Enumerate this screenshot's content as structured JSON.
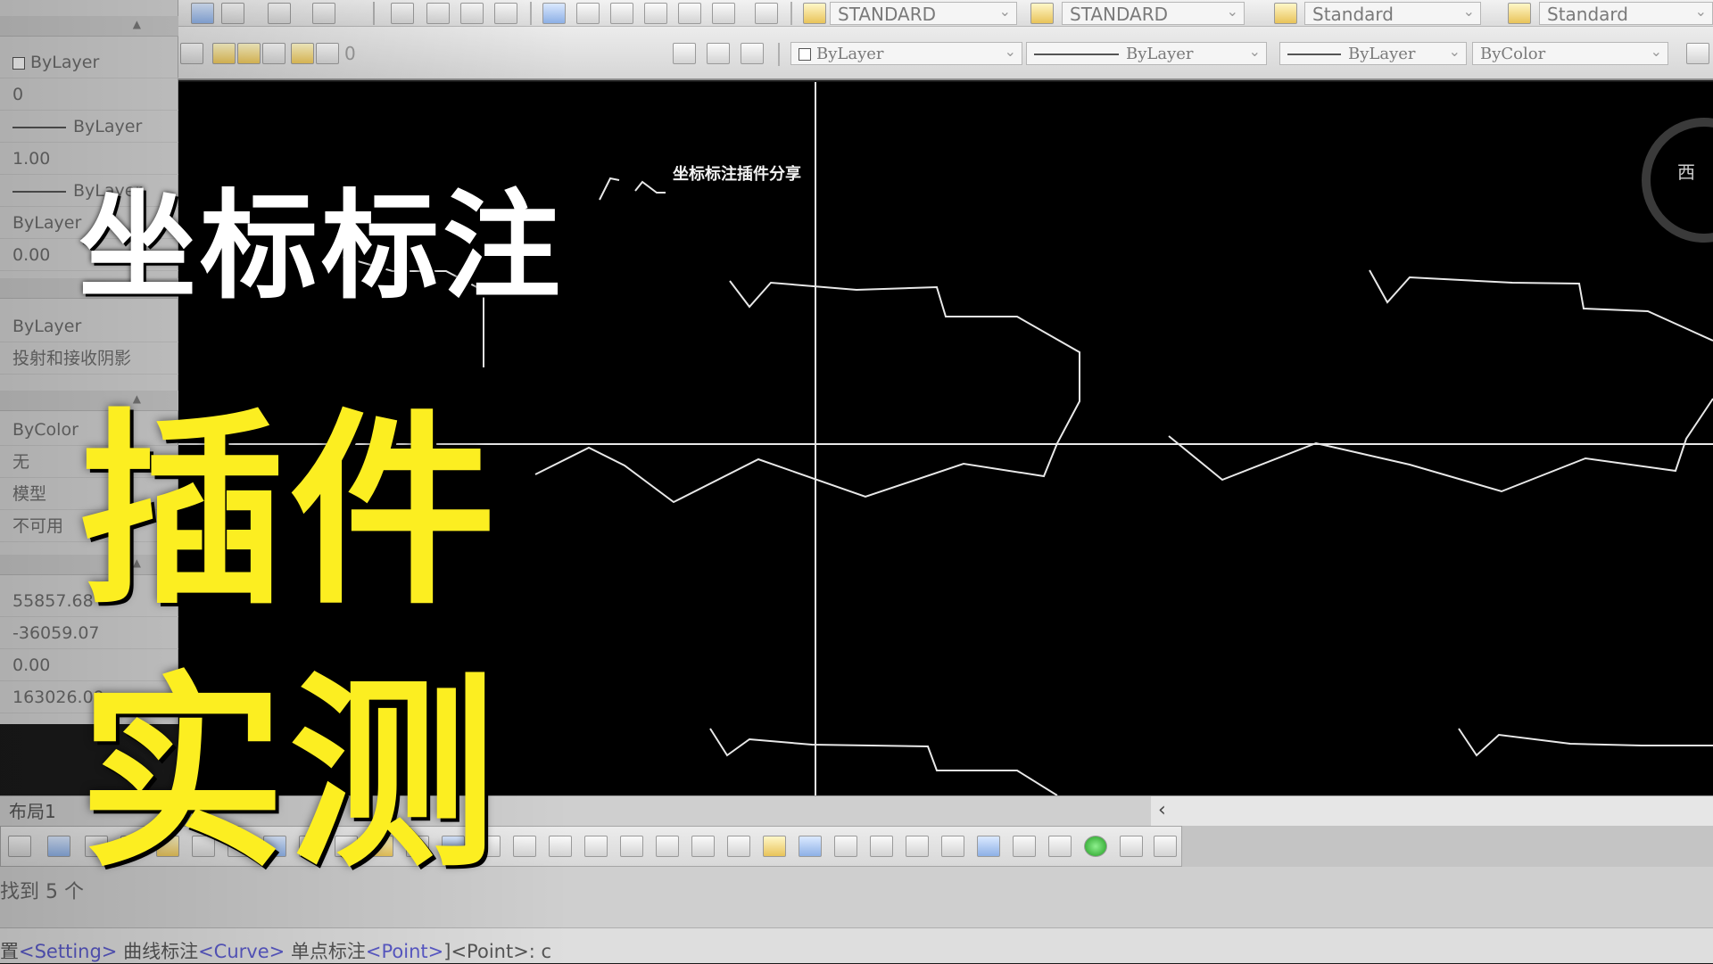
{
  "toolbar": {
    "text_style": "STANDARD",
    "dim_style": "STANDARD",
    "table_style": "Standard",
    "mleader_style": "Standard",
    "layer_value": "0",
    "color": "ByLayer",
    "linetype": "ByLayer",
    "lineweight": "ByLayer",
    "plot_style": "ByColor"
  },
  "properties": {
    "rows": [
      "ByLayer",
      "0",
      "ByLayer",
      "1.00",
      "ByLayer",
      "ByLayer",
      "0.00"
    ],
    "rows2": [
      "ByLayer",
      "投射和接收阴影"
    ],
    "rows3": [
      "ByColor",
      "无",
      "模型",
      "不可用"
    ],
    "rows4": [
      "55857.68",
      "-36059.07",
      "0.00",
      "163026.09"
    ]
  },
  "canvas": {
    "drawing_label": "坐标标注插件分享",
    "compass_label": "西"
  },
  "tabs": {
    "layout1": "布局1",
    "scroll_left": "‹"
  },
  "command": {
    "history": "找到 5 个",
    "line_prefix": "置",
    "kw_setting": "<Setting>",
    "curve_label": " 曲线标注",
    "kw_curve": "<Curve>",
    "point_label": " 单点标注",
    "kw_point": "<Point>",
    "line_suffix": "]<Point>: c"
  },
  "overlay": {
    "line1": "坐标标注",
    "line2": "插件",
    "line3": "实测"
  },
  "colors": {
    "canvas_bg": "#000000",
    "title_white": "#ffffff",
    "title_yellow": "#fcee21",
    "keyword": "#5a5ac8"
  }
}
